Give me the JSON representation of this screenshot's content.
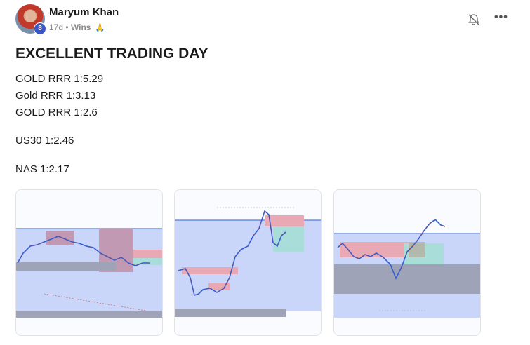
{
  "post": {
    "author": "Maryum Khan",
    "level": "8",
    "time_ago": "17d",
    "separator": "•",
    "category": "Wins",
    "category_emoji": "🙏",
    "title": "EXCELLENT TRADING DAY",
    "lines": [
      "GOLD RRR 1:5.29",
      "Gold RRR 1:3.13",
      "GOLD RRR 1:2.6",
      "US30 1:2.46",
      "NAS 1:2.17"
    ]
  },
  "icons": {
    "notifications": "bell-off-icon",
    "menu": "more-horizontal-icon"
  },
  "attachments": [
    {
      "name": "chart-screenshot-1"
    },
    {
      "name": "chart-screenshot-2"
    },
    {
      "name": "chart-screenshot-3"
    }
  ],
  "colors": {
    "zone_blue": "#c9d6fa",
    "zone_red": "#e8a9b4",
    "zone_teal": "#a9ddd9",
    "zone_grey": "#9ea3b8",
    "candle_up": "#2f5fd8",
    "candle_down": "#c0392b"
  }
}
